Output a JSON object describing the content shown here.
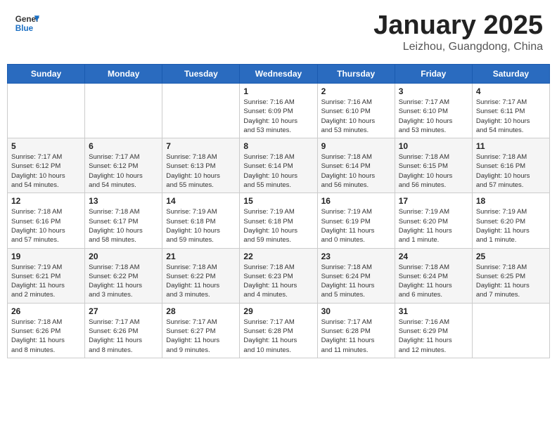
{
  "header": {
    "logo_general": "General",
    "logo_blue": "Blue",
    "title": "January 2025",
    "location": "Leizhou, Guangdong, China"
  },
  "weekdays": [
    "Sunday",
    "Monday",
    "Tuesday",
    "Wednesday",
    "Thursday",
    "Friday",
    "Saturday"
  ],
  "weeks": [
    [
      {
        "day": "",
        "info": ""
      },
      {
        "day": "",
        "info": ""
      },
      {
        "day": "",
        "info": ""
      },
      {
        "day": "1",
        "info": "Sunrise: 7:16 AM\nSunset: 6:09 PM\nDaylight: 10 hours\nand 53 minutes."
      },
      {
        "day": "2",
        "info": "Sunrise: 7:16 AM\nSunset: 6:10 PM\nDaylight: 10 hours\nand 53 minutes."
      },
      {
        "day": "3",
        "info": "Sunrise: 7:17 AM\nSunset: 6:10 PM\nDaylight: 10 hours\nand 53 minutes."
      },
      {
        "day": "4",
        "info": "Sunrise: 7:17 AM\nSunset: 6:11 PM\nDaylight: 10 hours\nand 54 minutes."
      }
    ],
    [
      {
        "day": "5",
        "info": "Sunrise: 7:17 AM\nSunset: 6:12 PM\nDaylight: 10 hours\nand 54 minutes."
      },
      {
        "day": "6",
        "info": "Sunrise: 7:17 AM\nSunset: 6:12 PM\nDaylight: 10 hours\nand 54 minutes."
      },
      {
        "day": "7",
        "info": "Sunrise: 7:18 AM\nSunset: 6:13 PM\nDaylight: 10 hours\nand 55 minutes."
      },
      {
        "day": "8",
        "info": "Sunrise: 7:18 AM\nSunset: 6:14 PM\nDaylight: 10 hours\nand 55 minutes."
      },
      {
        "day": "9",
        "info": "Sunrise: 7:18 AM\nSunset: 6:14 PM\nDaylight: 10 hours\nand 56 minutes."
      },
      {
        "day": "10",
        "info": "Sunrise: 7:18 AM\nSunset: 6:15 PM\nDaylight: 10 hours\nand 56 minutes."
      },
      {
        "day": "11",
        "info": "Sunrise: 7:18 AM\nSunset: 6:16 PM\nDaylight: 10 hours\nand 57 minutes."
      }
    ],
    [
      {
        "day": "12",
        "info": "Sunrise: 7:18 AM\nSunset: 6:16 PM\nDaylight: 10 hours\nand 57 minutes."
      },
      {
        "day": "13",
        "info": "Sunrise: 7:18 AM\nSunset: 6:17 PM\nDaylight: 10 hours\nand 58 minutes."
      },
      {
        "day": "14",
        "info": "Sunrise: 7:19 AM\nSunset: 6:18 PM\nDaylight: 10 hours\nand 59 minutes."
      },
      {
        "day": "15",
        "info": "Sunrise: 7:19 AM\nSunset: 6:18 PM\nDaylight: 10 hours\nand 59 minutes."
      },
      {
        "day": "16",
        "info": "Sunrise: 7:19 AM\nSunset: 6:19 PM\nDaylight: 11 hours\nand 0 minutes."
      },
      {
        "day": "17",
        "info": "Sunrise: 7:19 AM\nSunset: 6:20 PM\nDaylight: 11 hours\nand 1 minute."
      },
      {
        "day": "18",
        "info": "Sunrise: 7:19 AM\nSunset: 6:20 PM\nDaylight: 11 hours\nand 1 minute."
      }
    ],
    [
      {
        "day": "19",
        "info": "Sunrise: 7:19 AM\nSunset: 6:21 PM\nDaylight: 11 hours\nand 2 minutes."
      },
      {
        "day": "20",
        "info": "Sunrise: 7:18 AM\nSunset: 6:22 PM\nDaylight: 11 hours\nand 3 minutes."
      },
      {
        "day": "21",
        "info": "Sunrise: 7:18 AM\nSunset: 6:22 PM\nDaylight: 11 hours\nand 3 minutes."
      },
      {
        "day": "22",
        "info": "Sunrise: 7:18 AM\nSunset: 6:23 PM\nDaylight: 11 hours\nand 4 minutes."
      },
      {
        "day": "23",
        "info": "Sunrise: 7:18 AM\nSunset: 6:24 PM\nDaylight: 11 hours\nand 5 minutes."
      },
      {
        "day": "24",
        "info": "Sunrise: 7:18 AM\nSunset: 6:24 PM\nDaylight: 11 hours\nand 6 minutes."
      },
      {
        "day": "25",
        "info": "Sunrise: 7:18 AM\nSunset: 6:25 PM\nDaylight: 11 hours\nand 7 minutes."
      }
    ],
    [
      {
        "day": "26",
        "info": "Sunrise: 7:18 AM\nSunset: 6:26 PM\nDaylight: 11 hours\nand 8 minutes."
      },
      {
        "day": "27",
        "info": "Sunrise: 7:17 AM\nSunset: 6:26 PM\nDaylight: 11 hours\nand 8 minutes."
      },
      {
        "day": "28",
        "info": "Sunrise: 7:17 AM\nSunset: 6:27 PM\nDaylight: 11 hours\nand 9 minutes."
      },
      {
        "day": "29",
        "info": "Sunrise: 7:17 AM\nSunset: 6:28 PM\nDaylight: 11 hours\nand 10 minutes."
      },
      {
        "day": "30",
        "info": "Sunrise: 7:17 AM\nSunset: 6:28 PM\nDaylight: 11 hours\nand 11 minutes."
      },
      {
        "day": "31",
        "info": "Sunrise: 7:16 AM\nSunset: 6:29 PM\nDaylight: 11 hours\nand 12 minutes."
      },
      {
        "day": "",
        "info": ""
      }
    ]
  ]
}
